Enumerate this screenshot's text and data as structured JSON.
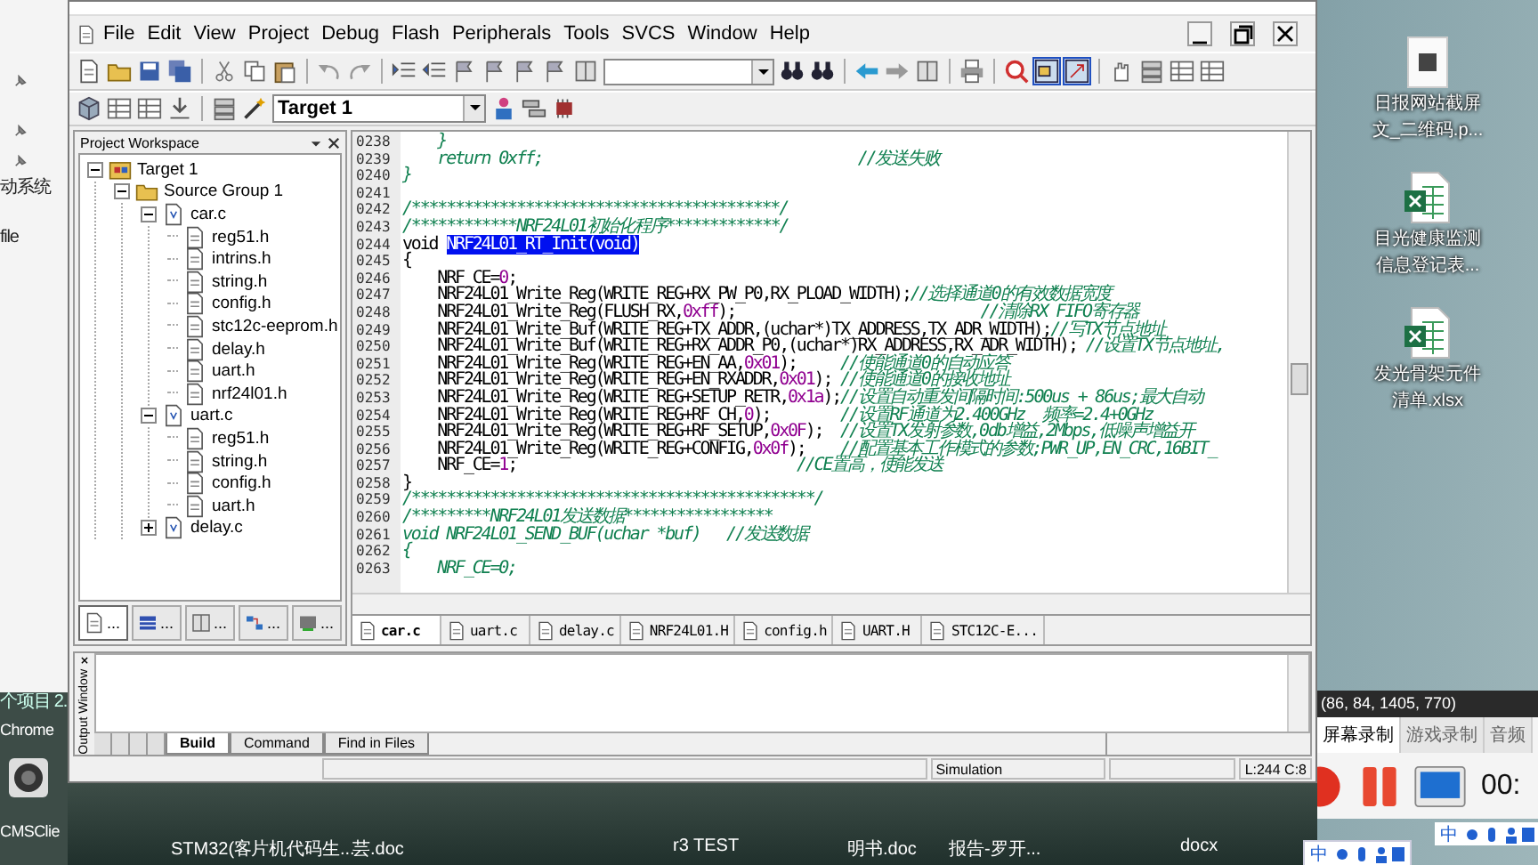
{
  "desktop": {
    "left_labels": [
      {
        "text": "动系统",
        "kind": "top"
      },
      {
        "text": "file",
        "kind": "mid"
      },
      {
        "text": "个项目 2.",
        "kind": "low"
      },
      {
        "text": "Chrome",
        "kind": "chrome"
      },
      {
        "text": "CMSClie",
        "kind": "bottom"
      }
    ],
    "icons": [
      {
        "label_lines": [
          "日报网站截屏",
          "文_二维码.p..."
        ],
        "kind": "qr-doc"
      },
      {
        "label_lines": [
          "目光健康监测",
          "信息登记表..."
        ],
        "kind": "excel"
      },
      {
        "label_lines": [
          "发光骨架元件",
          "清单.xlsx"
        ],
        "kind": "excel"
      }
    ],
    "bottom_labels": [
      "STM32(客",
      "片机代码生...",
      "芸.doc",
      "r3 TEST",
      "明书.doc",
      "报告-罗开...",
      "docx"
    ]
  },
  "window": {
    "menu": [
      "File",
      "Edit",
      "View",
      "Project",
      "Debug",
      "Flash",
      "Peripherals",
      "Tools",
      "SVCS",
      "Window",
      "Help"
    ],
    "toolbar": {
      "target": "Target 1"
    },
    "workspace": {
      "title": "Project Workspace",
      "tree": [
        {
          "label": "Target 1",
          "kind": "target",
          "expanded": true,
          "children": [
            {
              "label": "Source Group 1",
              "kind": "group",
              "expanded": true,
              "children": [
                {
                  "label": "car.c",
                  "kind": "file",
                  "expanded": true,
                  "children": [
                    {
                      "label": "reg51.h",
                      "kind": "header"
                    },
                    {
                      "label": "intrins.h",
                      "kind": "header"
                    },
                    {
                      "label": "string.h",
                      "kind": "header"
                    },
                    {
                      "label": "config.h",
                      "kind": "header"
                    },
                    {
                      "label": "stc12c-eeprom.h",
                      "kind": "header"
                    },
                    {
                      "label": "delay.h",
                      "kind": "header"
                    },
                    {
                      "label": "uart.h",
                      "kind": "header"
                    },
                    {
                      "label": "nrf24l01.h",
                      "kind": "header"
                    }
                  ]
                },
                {
                  "label": "uart.c",
                  "kind": "file",
                  "expanded": true,
                  "children": [
                    {
                      "label": "reg51.h",
                      "kind": "header"
                    },
                    {
                      "label": "string.h",
                      "kind": "header"
                    },
                    {
                      "label": "config.h",
                      "kind": "header"
                    },
                    {
                      "label": "uart.h",
                      "kind": "header"
                    }
                  ]
                },
                {
                  "label": "delay.c",
                  "kind": "file",
                  "expanded": false
                }
              ]
            }
          ]
        }
      ],
      "tabs": [
        {
          "label": "...",
          "kind": "files",
          "selected": true
        },
        {
          "label": "...",
          "kind": "regs",
          "selected": false
        },
        {
          "label": "...",
          "kind": "books",
          "selected": false
        },
        {
          "label": "...",
          "kind": "functions",
          "selected": false
        },
        {
          "label": "...",
          "kind": "templates",
          "selected": false
        }
      ]
    },
    "editor": {
      "lines": [
        {
          "number": "0238",
          "tokens": [
            {
              "kind": "comment",
              "text": "    }"
            }
          ]
        },
        {
          "number": "0239",
          "tokens": [
            {
              "kind": "comment",
              "text": "    return 0xff;                                    //发送失败"
            }
          ]
        },
        {
          "number": "0240",
          "tokens": [
            {
              "kind": "comment",
              "text": "}"
            }
          ]
        },
        {
          "number": "0241"
        },
        {
          "number": "0242",
          "tokens": [
            {
              "kind": "comment",
              "text": "/******************************************/"
            }
          ]
        },
        {
          "number": "0243",
          "tokens": [
            {
              "kind": "comment",
              "text": "/************NRF24L01初始化程序*************/"
            }
          ]
        },
        {
          "number": "0244",
          "tokens": [
            {
              "kind": "code",
              "text": "void "
            },
            {
              "kind": "selection",
              "text": "NRF24L01_RT_Init(void)"
            }
          ]
        },
        {
          "number": "0245",
          "tokens": [
            {
              "kind": "code",
              "text": "{"
            }
          ]
        },
        {
          "number": "0246",
          "tokens": [
            {
              "kind": "code",
              "text": "    NRF_CE="
            },
            {
              "kind": "number",
              "text": "0"
            },
            {
              "kind": "code",
              "text": ";"
            }
          ]
        },
        {
          "number": "0247",
          "tokens": [
            {
              "kind": "code",
              "text": "    NRF24L01_Write_Reg(WRITE_REG+RX_PW_P0,RX_PLOAD_WIDTH);"
            },
            {
              "kind": "comment",
              "text": "//选择通道0的有效数据宽度"
            }
          ]
        },
        {
          "number": "0248",
          "tokens": [
            {
              "kind": "code",
              "text": "    NRF24L01_Write_Reg(FLUSH_RX,"
            },
            {
              "kind": "number",
              "text": "0xff"
            },
            {
              "kind": "code",
              "text": ");                            "
            },
            {
              "kind": "comment",
              "text": "//清除RX FIFO寄存器"
            }
          ]
        },
        {
          "number": "0249",
          "tokens": [
            {
              "kind": "code",
              "text": "    NRF24L01_Write_Buf(WRITE_REG+TX_ADDR,(uchar*)TX_ADDRESS,TX_ADR_WIDTH);"
            },
            {
              "kind": "comment",
              "text": "//写TX节点地址"
            }
          ]
        },
        {
          "number": "0250",
          "tokens": [
            {
              "kind": "code",
              "text": "    NRF24L01_Write_Buf(WRITE_REG+RX_ADDR_P0,(uchar*)RX_ADDRESS,RX_ADR_WIDTH); "
            },
            {
              "kind": "comment",
              "text": "//设置TX节点地址,"
            }
          ]
        },
        {
          "number": "0251",
          "tokens": [
            {
              "kind": "code",
              "text": "    NRF24L01_Write_Reg(WRITE_REG+EN_AA,"
            },
            {
              "kind": "number",
              "text": "0x01"
            },
            {
              "kind": "code",
              "text": ");     "
            },
            {
              "kind": "comment",
              "text": "//使能通道0的自动应答"
            }
          ]
        },
        {
          "number": "0252",
          "tokens": [
            {
              "kind": "code",
              "text": "    NRF24L01_Write_Reg(WRITE_REG+EN_RXADDR,"
            },
            {
              "kind": "number",
              "text": "0x01"
            },
            {
              "kind": "code",
              "text": "); "
            },
            {
              "kind": "comment",
              "text": "//使能通道0的接收地址"
            }
          ]
        },
        {
          "number": "0253",
          "tokens": [
            {
              "kind": "code",
              "text": "    NRF24L01_Write_Reg(WRITE_REG+SETUP_RETR,"
            },
            {
              "kind": "number",
              "text": "0x1a"
            },
            {
              "kind": "code",
              "text": ");"
            },
            {
              "kind": "comment",
              "text": "//设置自动重发间隔时间:500us + 86us;最大自动"
            }
          ]
        },
        {
          "number": "0254",
          "tokens": [
            {
              "kind": "code",
              "text": "    NRF24L01_Write_Reg(WRITE_REG+RF_CH,"
            },
            {
              "kind": "number",
              "text": "0"
            },
            {
              "kind": "code",
              "text": ");        "
            },
            {
              "kind": "comment",
              "text": "//设置RF通道为2.400GHz  频率=2.4+0GHz"
            }
          ]
        },
        {
          "number": "0255",
          "tokens": [
            {
              "kind": "code",
              "text": "    NRF24L01_Write_Reg(WRITE_REG+RF_SETUP,"
            },
            {
              "kind": "number",
              "text": "0x0F"
            },
            {
              "kind": "code",
              "text": ");  "
            },
            {
              "kind": "comment",
              "text": "//设置TX发射参数,0db增益,2Mbps,低噪声增益开"
            }
          ]
        },
        {
          "number": "0256",
          "tokens": [
            {
              "kind": "code",
              "text": "    NRF24L01_Write_Reg(WRITE_REG+CONFIG,"
            },
            {
              "kind": "number",
              "text": "0x0f"
            },
            {
              "kind": "code",
              "text": ");    "
            },
            {
              "kind": "comment",
              "text": "//配置基本工作模式的参数;PWR_UP,EN_CRC,16BIT_"
            }
          ]
        },
        {
          "number": "0257",
          "tokens": [
            {
              "kind": "code",
              "text": "    NRF_CE="
            },
            {
              "kind": "number",
              "text": "1"
            },
            {
              "kind": "code",
              "text": ";                                "
            },
            {
              "kind": "comment",
              "text": "//CE置高，使能发送"
            }
          ]
        },
        {
          "number": "0258",
          "tokens": [
            {
              "kind": "code",
              "text": "}"
            }
          ]
        },
        {
          "number": "0259",
          "tokens": [
            {
              "kind": "comment",
              "text": "/**********************************************/"
            }
          ]
        },
        {
          "number": "0260",
          "tokens": [
            {
              "kind": "comment",
              "text": "/*********NRF24L01发送数据*****************"
            }
          ]
        },
        {
          "number": "0261",
          "tokens": [
            {
              "kind": "comment",
              "text": "void NRF24L01_SEND_BUF(uchar *buf)   //发送数据"
            }
          ]
        },
        {
          "number": "0262",
          "tokens": [
            {
              "kind": "comment",
              "text": "{"
            }
          ]
        },
        {
          "number": "0263",
          "tokens": [
            {
              "kind": "comment",
              "text": "    NRF_CE=0;"
            }
          ]
        }
      ],
      "tabs": [
        {
          "label": "car.c",
          "selected": true
        },
        {
          "label": "uart.c",
          "selected": false
        },
        {
          "label": "delay.c",
          "selected": false
        },
        {
          "label": "NRF24L01.H",
          "selected": false
        },
        {
          "label": "config.h",
          "selected": false
        },
        {
          "label": "UART.H",
          "selected": false
        },
        {
          "label": "STC12C-E...",
          "selected": false
        }
      ]
    },
    "output": {
      "title": "Output Window",
      "tabs": [
        {
          "label": "Build",
          "selected": true
        },
        {
          "label": "Command",
          "selected": false
        },
        {
          "label": "Find in Files",
          "selected": false
        }
      ]
    },
    "status_bar": {
      "mode": "Simulation",
      "position": "L:244 C:8"
    }
  },
  "recorder": {
    "region": "(86, 84, 1405, 770)",
    "tabs": [
      {
        "label": "屏幕录制",
        "selected": true
      },
      {
        "label": "游戏录制",
        "selected": false
      },
      {
        "label": "音频",
        "selected": false
      }
    ],
    "timer": "00:"
  },
  "ime_bars": [
    "中",
    "中"
  ]
}
